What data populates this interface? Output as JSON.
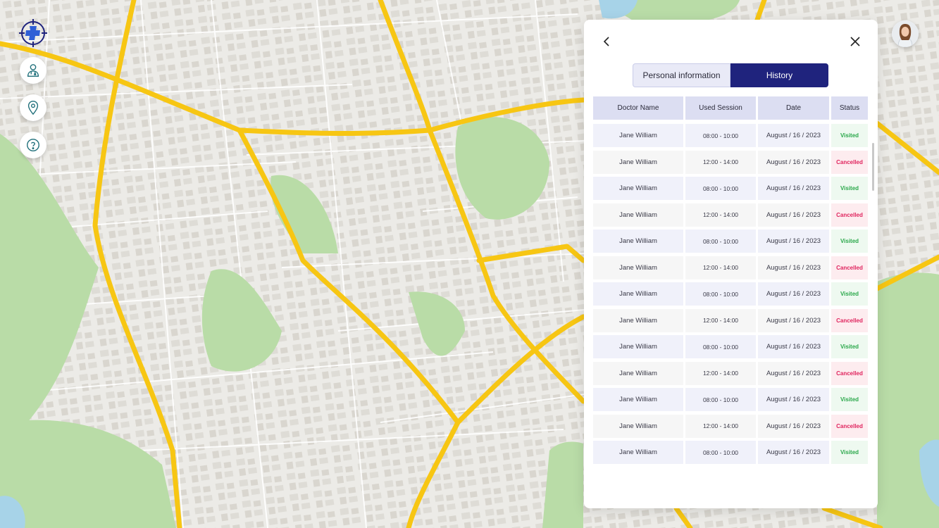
{
  "tabs": {
    "personal": "Personal information",
    "history": "History"
  },
  "table": {
    "headers": {
      "doctor": "Doctor Name",
      "session": "Used Session",
      "date": "Date",
      "status": "Status"
    },
    "rows": [
      {
        "doctor": "Jane William",
        "session": "08:00 - 10:00",
        "date": "August / 16 / 2023",
        "status": "Visited"
      },
      {
        "doctor": "Jane William",
        "session": "12:00 - 14:00",
        "date": "August / 16 / 2023",
        "status": "Cancelled"
      },
      {
        "doctor": "Jane William",
        "session": "08:00 - 10:00",
        "date": "August / 16 / 2023",
        "status": "Visited"
      },
      {
        "doctor": "Jane William",
        "session": "12:00 - 14:00",
        "date": "August / 16 / 2023",
        "status": "Cancelled"
      },
      {
        "doctor": "Jane William",
        "session": "08:00 - 10:00",
        "date": "August / 16 / 2023",
        "status": "Visited"
      },
      {
        "doctor": "Jane William",
        "session": "12:00 - 14:00",
        "date": "August / 16 / 2023",
        "status": "Cancelled"
      },
      {
        "doctor": "Jane William",
        "session": "08:00 - 10:00",
        "date": "August / 16 / 2023",
        "status": "Visited"
      },
      {
        "doctor": "Jane William",
        "session": "12:00 - 14:00",
        "date": "August / 16 / 2023",
        "status": "Cancelled"
      },
      {
        "doctor": "Jane William",
        "session": "08:00 - 10:00",
        "date": "August / 16 / 2023",
        "status": "Visited"
      },
      {
        "doctor": "Jane William",
        "session": "12:00 - 14:00",
        "date": "August / 16 / 2023",
        "status": "Cancelled"
      },
      {
        "doctor": "Jane William",
        "session": "08:00 - 10:00",
        "date": "August / 16 / 2023",
        "status": "Visited"
      },
      {
        "doctor": "Jane William",
        "session": "12:00 - 14:00",
        "date": "August / 16 / 2023",
        "status": "Cancelled"
      },
      {
        "doctor": "Jane William",
        "session": "08:00 - 10:00",
        "date": "August / 16 / 2023",
        "status": "Visited"
      }
    ]
  },
  "icons": {
    "logo": "medical-cross-crosshair-icon",
    "toolbar": [
      "doctor-icon",
      "location-pin-icon",
      "help-icon"
    ],
    "panel_back": "chevron-left-icon",
    "panel_close": "close-icon"
  },
  "colors": {
    "accent": "#1f237d",
    "logo_cross": "#2f5fd6",
    "toolbar_icon": "#1f6f7a",
    "visited": "#2aa84a",
    "cancelled": "#e0245e",
    "road": "#f7c613",
    "park": "#b9dca7",
    "water": "#a7d3e8"
  }
}
